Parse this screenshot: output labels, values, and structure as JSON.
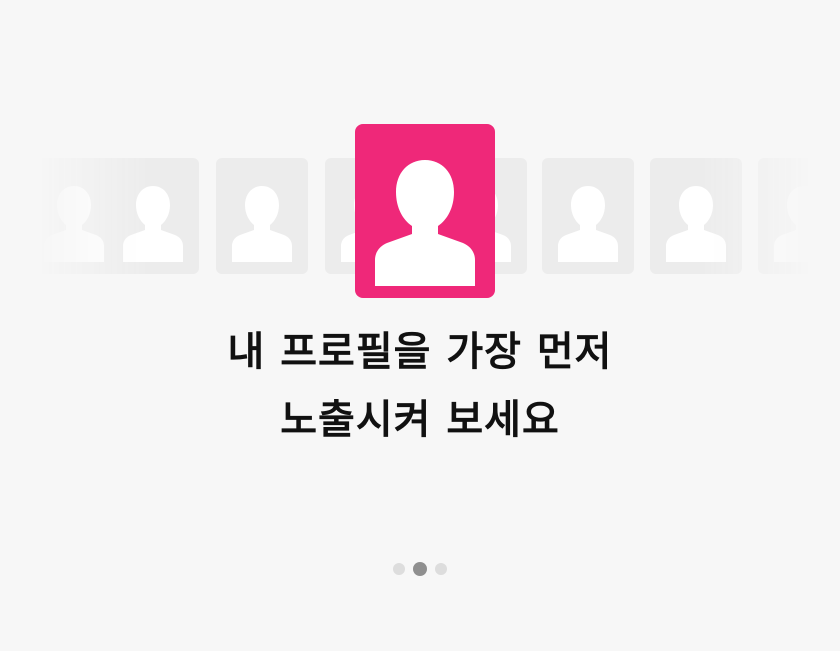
{
  "onboarding": {
    "headline_line1": "내 프로필을 가장 먼저",
    "headline_line2": "노출시켜 보세요",
    "icons": {
      "hero": "user-profile-icon",
      "thumbnail": "user-silhouette-icon"
    },
    "colors": {
      "accent": "#ef2879",
      "background": "#f7f7f7",
      "thumbnail_bg": "#ececec",
      "thumbnail_icon": "#ffffff",
      "text": "#111111",
      "dot_active": "#8f8f8f",
      "dot_inactive": "#dddddd"
    },
    "pagination": {
      "total": 3,
      "current": 2
    }
  }
}
